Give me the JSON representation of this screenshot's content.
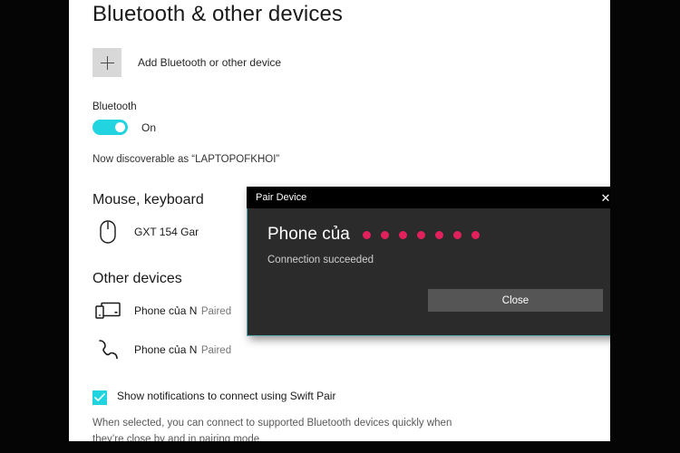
{
  "page": {
    "title": "Bluetooth & other devices"
  },
  "add_device": {
    "icon": "plus-icon",
    "label": "Add Bluetooth or other device"
  },
  "bluetooth": {
    "section_label": "Bluetooth",
    "toggle_state": "On",
    "toggle_on": true,
    "discoverable_text": "Now discoverable as “LAPTOPOFKHOI”",
    "accent_color": "#21d4e0"
  },
  "groups": [
    {
      "heading": "Mouse, keyboard",
      "devices": [
        {
          "icon": "mouse-icon",
          "name": "GXT 154 Gar",
          "status": ""
        }
      ]
    },
    {
      "heading": "Other devices",
      "devices": [
        {
          "icon": "tablet-icon",
          "name": "Phone của N",
          "status": "Paired"
        },
        {
          "icon": "phone-handset-icon",
          "name": "Phone của N",
          "status": "Paired"
        }
      ]
    }
  ],
  "swift_pair": {
    "checkbox_checked": true,
    "label": "Show notifications to connect using Swift Pair",
    "description": "When selected, you can connect to supported Bluetooth devices quickly when they’re close by and in pairing mode."
  },
  "dialog": {
    "title": "Pair Device",
    "close_icon": "close-icon",
    "device_name": "Phone của",
    "redacted_dot_count": 7,
    "redaction_color": "#e0215c",
    "status_text": "Connection succeeded",
    "close_button_label": "Close",
    "border_color": "#55a6ad",
    "body_color": "#2b2b2b"
  }
}
